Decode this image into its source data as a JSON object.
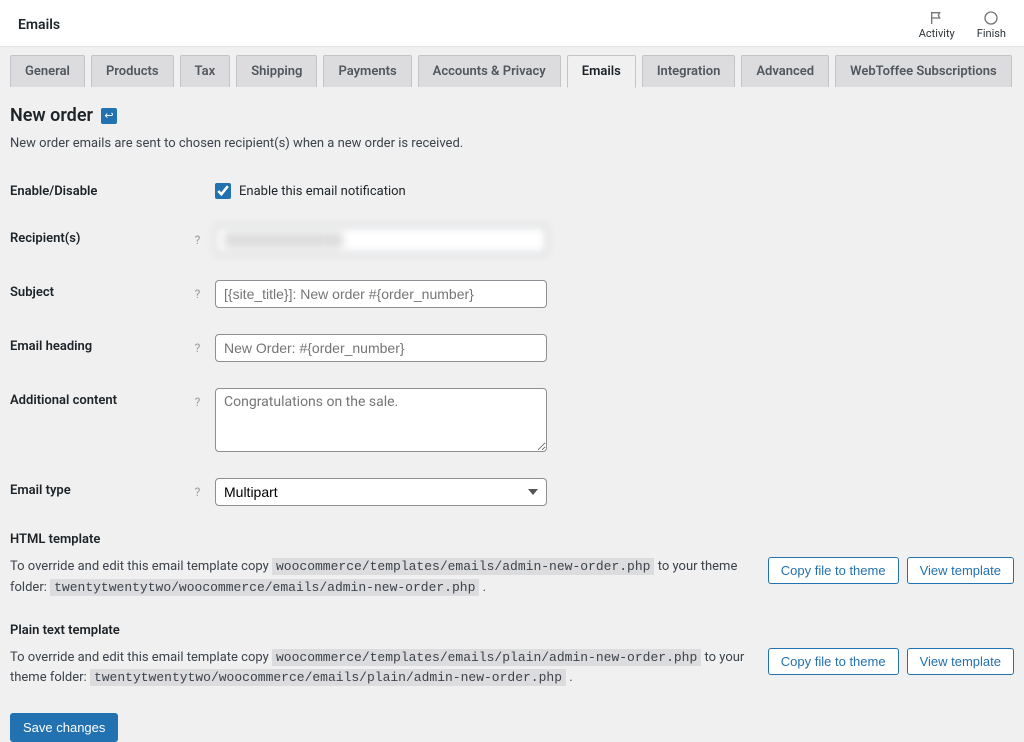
{
  "header": {
    "title": "Emails",
    "right": [
      {
        "label": "Activity"
      },
      {
        "label": "Finish"
      }
    ]
  },
  "tabs": [
    {
      "label": "General",
      "active": false
    },
    {
      "label": "Products",
      "active": false
    },
    {
      "label": "Tax",
      "active": false
    },
    {
      "label": "Shipping",
      "active": false
    },
    {
      "label": "Payments",
      "active": false
    },
    {
      "label": "Accounts & Privacy",
      "active": false
    },
    {
      "label": "Emails",
      "active": true
    },
    {
      "label": "Integration",
      "active": false
    },
    {
      "label": "Advanced",
      "active": false
    },
    {
      "label": "WebToffee Subscriptions",
      "active": false
    }
  ],
  "page": {
    "title": "New order",
    "description": "New order emails are sent to chosen recipient(s) when a new order is received."
  },
  "form": {
    "enable_label": "Enable/Disable",
    "enable_checkbox_label": "Enable this email notification",
    "enable_checked": true,
    "recipient_label": "Recipient(s)",
    "recipient_value": "",
    "subject_label": "Subject",
    "subject_placeholder": "[{site_title}]: New order #{order_number}",
    "heading_label": "Email heading",
    "heading_placeholder": "New Order: #{order_number}",
    "additional_label": "Additional content",
    "additional_placeholder": "Congratulations on the sale.",
    "type_label": "Email type",
    "type_value": "Multipart"
  },
  "templates": {
    "html": {
      "title": "HTML template",
      "pre_text": "To override and edit this email template copy",
      "src_path": "woocommerce/templates/emails/admin-new-order.php",
      "mid_text": "to your theme folder:",
      "dst_path": "twentytwentytwo/woocommerce/emails/admin-new-order.php",
      "end": "."
    },
    "plain": {
      "title": "Plain text template",
      "pre_text": "To override and edit this email template copy",
      "src_path": "woocommerce/templates/emails/plain/admin-new-order.php",
      "mid_text": "to your theme folder:",
      "dst_path": "twentytwentytwo/woocommerce/emails/plain/admin-new-order.php",
      "end": "."
    },
    "copy_button": "Copy file to theme",
    "view_button": "View template"
  },
  "save_button": "Save changes"
}
